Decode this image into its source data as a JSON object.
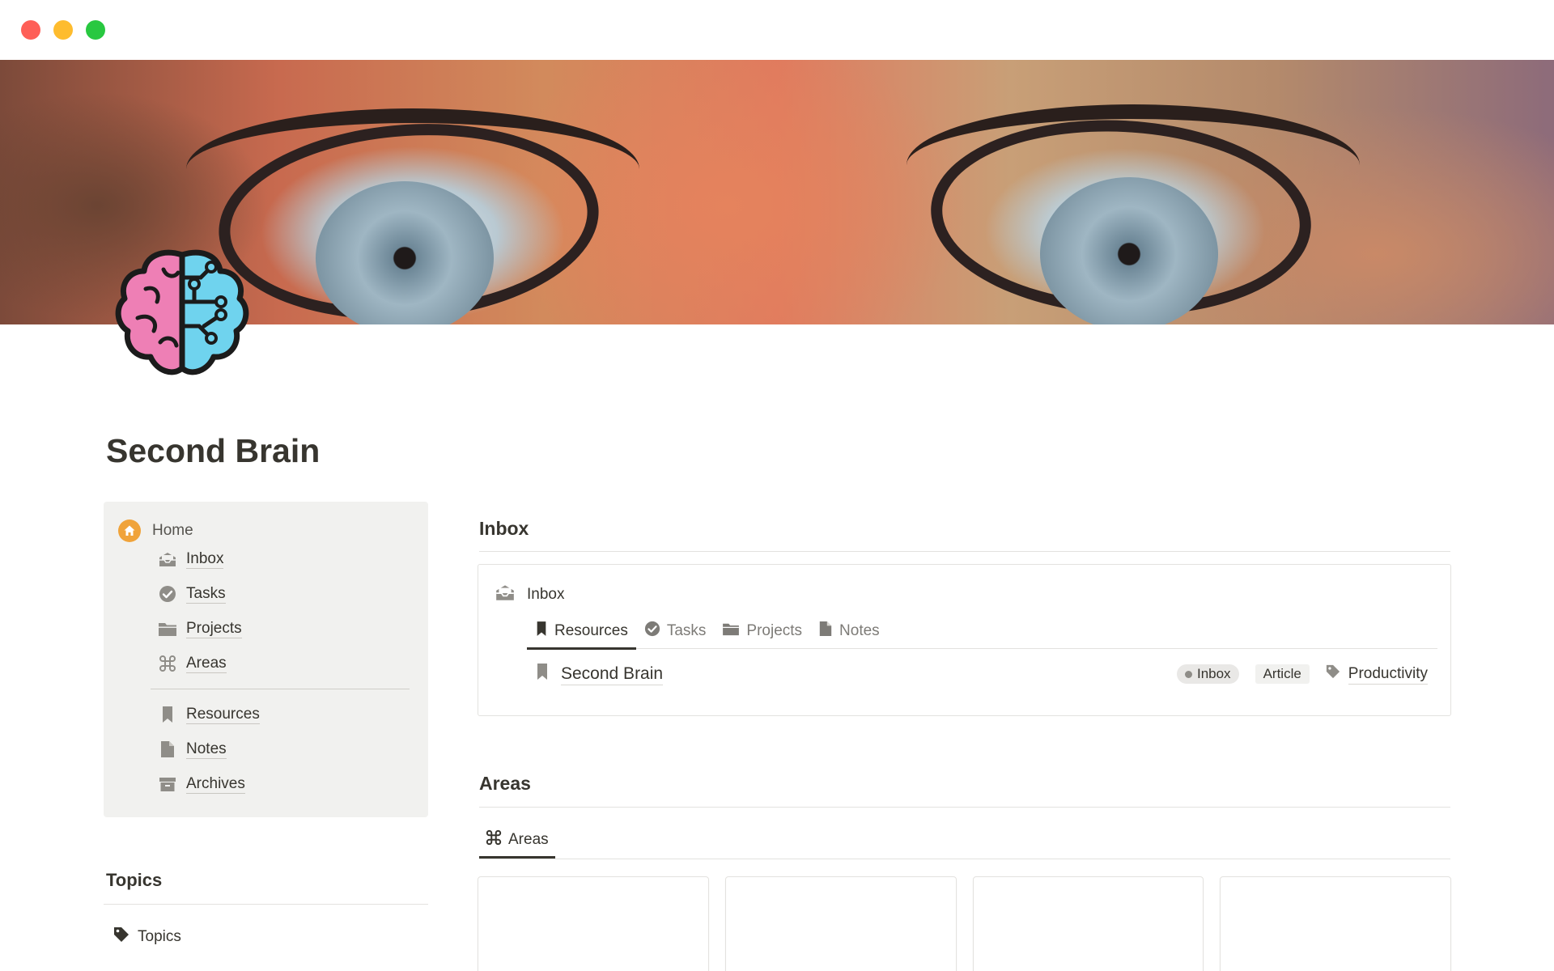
{
  "window": {
    "traffic_lights": [
      "close",
      "minimize",
      "zoom"
    ]
  },
  "page": {
    "title": "Second Brain"
  },
  "nav": {
    "home": "Home",
    "items": [
      {
        "label": "Inbox",
        "icon": "inbox-tray-icon"
      },
      {
        "label": "Tasks",
        "icon": "check-circle-icon"
      },
      {
        "label": "Projects",
        "icon": "folder-icon"
      },
      {
        "label": "Areas",
        "icon": "command-icon"
      },
      {
        "label": "Resources",
        "icon": "bookmark-icon"
      },
      {
        "label": "Notes",
        "icon": "document-icon"
      },
      {
        "label": "Archives",
        "icon": "archive-box-icon"
      }
    ]
  },
  "topics": {
    "heading": "Topics",
    "item": "Topics"
  },
  "inbox_section": {
    "heading": "Inbox",
    "panel_title": "Inbox",
    "tabs": [
      {
        "label": "Resources",
        "icon": "bookmark-icon",
        "active": true
      },
      {
        "label": "Tasks",
        "icon": "check-circle-icon",
        "active": false
      },
      {
        "label": "Projects",
        "icon": "folder-icon",
        "active": false
      },
      {
        "label": "Notes",
        "icon": "document-icon",
        "active": false
      }
    ],
    "rows": [
      {
        "title": "Second Brain",
        "status": "Inbox",
        "type": "Article",
        "topic": "Productivity"
      }
    ]
  },
  "areas_section": {
    "heading": "Areas",
    "tab": "Areas"
  },
  "colors": {
    "accent": "#37352f",
    "nav_bg": "#f1f1ef",
    "home_icon": "#f0a33a"
  }
}
